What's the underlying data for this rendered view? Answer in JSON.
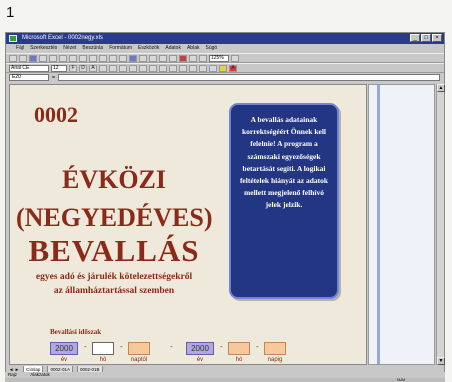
{
  "figure_number": "1",
  "window": {
    "title": "Microsoft Excel - 0002negy.xls"
  },
  "menu": [
    "Fájl",
    "Szerkesztés",
    "Nézet",
    "Beszúrás",
    "Formátum",
    "Eszközök",
    "Adatok",
    "Ablak",
    "Súgó"
  ],
  "toolbar": {
    "font_name": "Arial CE",
    "font_size": "12",
    "zoom": "125%"
  },
  "formula_bar": {
    "name_box": "E20",
    "fx_symbol": "="
  },
  "form": {
    "code": "0002",
    "title_line1": "ÉVKÖZI",
    "title_line2": "(NEGYEDÉVES)",
    "title_line3": "BEVALLÁS",
    "subtitle_line1": "egyes adó és járulék kötelezettségekről",
    "subtitle_line2": "az államháztartással szemben",
    "info_text": "A bevallás adatainak korrektségéért Önnek kell felelnie! A program a számszaki egyezőségek betartását segíti. A logikai feltételek hiányát az adatok mellett megjelenő felhívó jelek jelzik.",
    "period_label": "Bevallási időszak",
    "period_start": {
      "year": "2000",
      "month": "",
      "day": "",
      "year_label": "év",
      "month_label": "hó",
      "day_label": "naptól"
    },
    "period_end": {
      "year": "2000",
      "month": "",
      "day": "",
      "year_label": "év",
      "month_label": "hó",
      "day_label": "napig"
    },
    "dash": "-"
  },
  "sheet_tabs": [
    "Címlap",
    "0002-01A",
    "0002-01B"
  ],
  "draw_toolbar": {
    "draw_label": "Rajz",
    "autoshapes_label": "Alakzatok"
  },
  "status_bar": {
    "num_indicator": "NUM"
  },
  "colors": {
    "title_red": "#8a2a18",
    "info_box_blue": "#233684",
    "year_box_purple": "#b0a8e0",
    "day_box_orange": "#f6c89c",
    "sheet_bg": "#efe9dc"
  }
}
